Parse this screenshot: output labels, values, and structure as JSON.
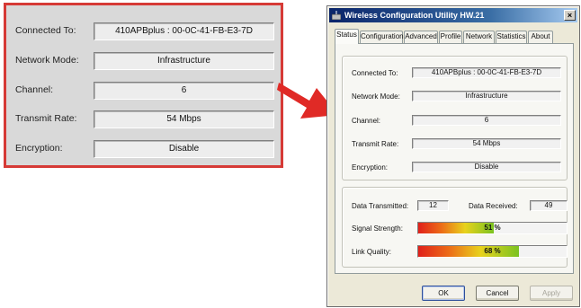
{
  "zoom_view": {
    "rows": [
      {
        "label": "Connected To:",
        "value": "410APBplus : 00-0C-41-FB-E3-7D"
      },
      {
        "label": "Network Mode:",
        "value": "Infrastructure"
      },
      {
        "label": "Channel:",
        "value": "6"
      },
      {
        "label": "Transmit Rate:",
        "value": "54 Mbps"
      },
      {
        "label": "Encryption:",
        "value": "Disable"
      }
    ],
    "border_color": "#d63a36"
  },
  "window": {
    "title": "Wireless Configuration Utility HW.21",
    "close_label": "×",
    "tabs": [
      {
        "label": "Status",
        "active": true
      },
      {
        "label": "Configuration",
        "active": false
      },
      {
        "label": "Advanced",
        "active": false
      },
      {
        "label": "Profile",
        "active": false
      },
      {
        "label": "Network",
        "active": false
      },
      {
        "label": "Statistics",
        "active": false
      },
      {
        "label": "About",
        "active": false
      }
    ],
    "status": {
      "fields": [
        {
          "label": "Connected To:",
          "value": "410APBplus : 00-0C-41-FB-E3-7D"
        },
        {
          "label": "Network Mode:",
          "value": "Infrastructure"
        },
        {
          "label": "Channel:",
          "value": "6"
        },
        {
          "label": "Transmit Rate:",
          "value": "54 Mbps"
        },
        {
          "label": "Encryption:",
          "value": "Disable"
        }
      ],
      "data_transmitted_label": "Data Transmitted:",
      "data_transmitted": "12",
      "data_received_label": "Data Received:",
      "data_received": "49",
      "signal_strength_label": "Signal Strength:",
      "signal_strength_text": "51 %",
      "signal_strength_value": 51,
      "link_quality_label": "Link Quality:",
      "link_quality_text": "68 %",
      "link_quality_value": 68
    },
    "buttons": {
      "ok": "OK",
      "cancel": "Cancel",
      "apply": "Apply"
    }
  },
  "icons": {
    "app": "wireless-app-icon",
    "arrow": "arrow-right-icon"
  },
  "colors": {
    "arrow": "#e02a26",
    "titlebar": "#0a246a"
  }
}
